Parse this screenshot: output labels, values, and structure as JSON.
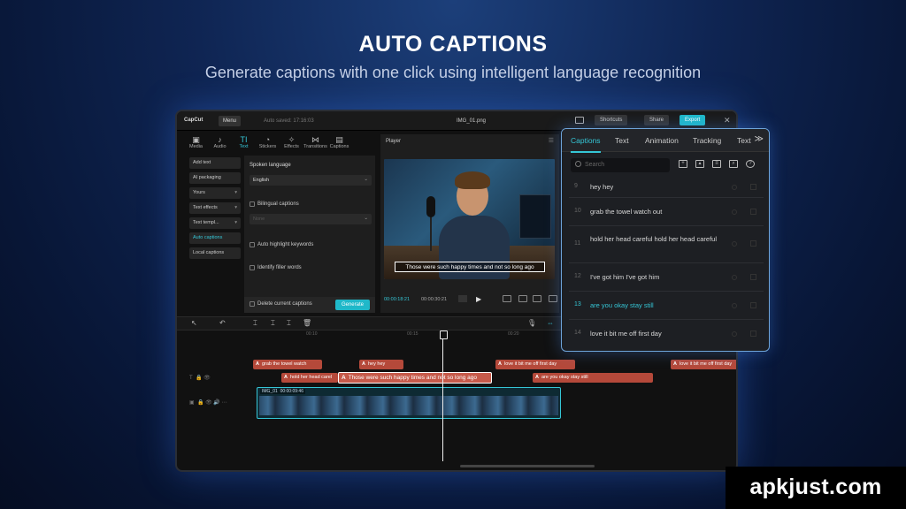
{
  "hero": {
    "title": "AUTO CAPTIONS",
    "subtitle": "Generate captions with one click using intelligent language recognition"
  },
  "app": {
    "logo": "CapCut",
    "menu_label": "Menu",
    "autosave": "Auto saved: 17:16:03",
    "file_name": "IMG_01.png",
    "shortcuts_label": "Shortcuts",
    "share_label": "Share",
    "export_label": "Export",
    "close_glyph": "✕",
    "accent_color": "#1fb8c9"
  },
  "toolbar": [
    {
      "label": "Media",
      "icon": "▣"
    },
    {
      "label": "Audio",
      "icon": "♪"
    },
    {
      "label": "Text",
      "icon": "TI"
    },
    {
      "label": "Stickers",
      "icon": "◔"
    },
    {
      "label": "Effects",
      "icon": "✧"
    },
    {
      "label": "Transitions",
      "icon": "⋈"
    },
    {
      "label": "Captions",
      "icon": "▤"
    }
  ],
  "left_menu": [
    {
      "label": "Add text"
    },
    {
      "label": "AI packaging"
    },
    {
      "label": "Yours"
    },
    {
      "label": "Text effects"
    },
    {
      "label": "Text templ..."
    },
    {
      "label": "Auto captions"
    },
    {
      "label": "Local captions"
    }
  ],
  "caption_settings": {
    "spoken_language_label": "Spoken language",
    "language_value": "English",
    "bilingual_label": "Bilingual captions",
    "bilingual_placeholder": "None",
    "highlight_label": "Auto highlight keywords",
    "filler_label": "Identify filler words",
    "delete_label": "Delete current captions",
    "generate_label": "Generate"
  },
  "player": {
    "title": "Player",
    "caption_text": "Those were such happy times and not so long ago",
    "current_time": "00:00:18:21",
    "total_time": "00:00:30:21",
    "play_glyph": "▶"
  },
  "captions_panel": {
    "tabs": [
      "Captions",
      "Text",
      "Animation",
      "Tracking",
      "Text"
    ],
    "more_glyph": "≫",
    "search_placeholder": "Search",
    "rows": [
      {
        "num": "9",
        "text": "hey hey"
      },
      {
        "num": "10",
        "text": "grab the towel watch out"
      },
      {
        "num": "11",
        "text": "hold her head careful hold her head careful"
      },
      {
        "num": "12",
        "text": "I've got him I've got him"
      },
      {
        "num": "13",
        "text": "are you okay stay still"
      },
      {
        "num": "14",
        "text": "love it bit me off first day"
      }
    ]
  },
  "timeline": {
    "ruler": [
      "00:10",
      "00:15",
      "00:20"
    ],
    "caption_track_1": [
      "grab the towel watch",
      "hey hey",
      "love it bit me off first day",
      "love it bit me off first day"
    ],
    "caption_track_2": [
      "hold her head carel",
      "Those were such happy times and not so long ago",
      "are you okay stay still"
    ],
    "video_label": "IMG_01",
    "video_duration": "00:00:09:46"
  },
  "watermark": "apkjust.com"
}
